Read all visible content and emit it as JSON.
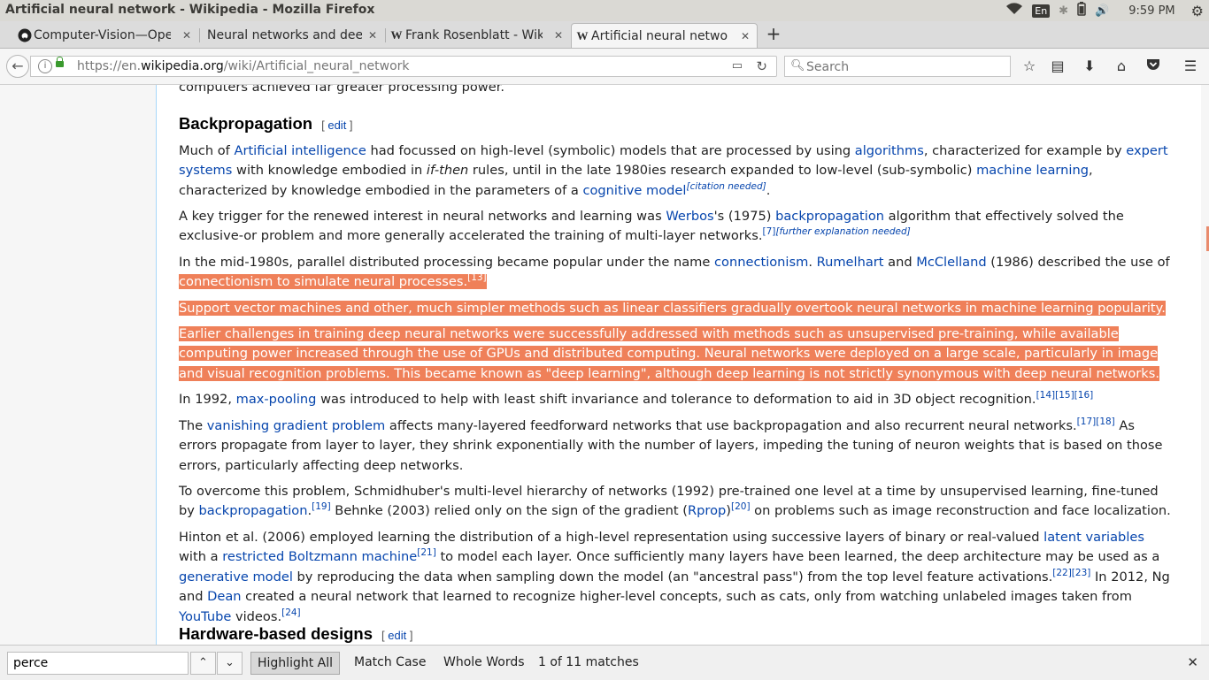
{
  "os": {
    "window_title": "Artificial neural network - Wikipedia - Mozilla Firefox",
    "input_lang": "En",
    "time": "9:59 PM"
  },
  "tabs": [
    {
      "title": "Computer-Vision—Ope",
      "favicon": "github-icon",
      "icon_char": "●"
    },
    {
      "title": "Neural networks and deep",
      "favicon": "none",
      "icon_char": ""
    },
    {
      "title": "Frank Rosenblatt - Wiki",
      "favicon": "wikipedia-icon",
      "icon_char": "W"
    },
    {
      "title": "Artificial neural netwo",
      "favicon": "wikipedia-icon",
      "icon_char": "W",
      "active": true
    }
  ],
  "nav": {
    "url_prefix": "https://en.",
    "url_domain": "wikipedia.org",
    "url_path": "/wiki/Artificial_neural_network",
    "search_placeholder": "Search"
  },
  "article": {
    "top_cut": "computers achieved far greater processing power.",
    "section1": {
      "title": "Backpropagation",
      "edit": "edit"
    },
    "p1": {
      "t1": "Much of ",
      "l1": "Artificial intelligence",
      "t2": " had focussed on high-level (symbolic) models that are processed by using ",
      "l2": "algorithms",
      "t3": ", characterized for example by ",
      "l3": "expert systems",
      "t4": " with knowledge embodied in ",
      "em": "if-then",
      "t5": " rules, until in the late 1980ies research expanded to low-level (sub-symbolic) ",
      "l4": "machine learning",
      "t6": ", characterized by knowledge embodied in the parameters of a ",
      "l5": "cognitive model",
      "sup": "[citation needed]",
      "t7": "."
    },
    "p2": {
      "t1": "A key trigger for the renewed interest in neural networks and learning was ",
      "l1": "Werbos",
      "t2": "'s (1975) ",
      "l2": "backpropagation",
      "t3": " algorithm that effectively solved the exclusive-or problem and more generally accelerated the training of multi-layer networks.",
      "sup1": "[7]",
      "sup2": "[further explanation needed]"
    },
    "p3": {
      "t1": "In the mid-1980s, parallel distributed processing became popular under the name ",
      "l1": "connectionism",
      "t2": ". ",
      "l2": "Rumelhart",
      "t3": " and ",
      "l3": "McClelland",
      "t4": " (1986) described the use of ",
      "hl": "connectionism to simulate neural processes.",
      "sup": "[13]"
    },
    "p4": "Support vector machines and other, much simpler methods such as linear classifiers gradually overtook neural networks in machine learning popularity.",
    "p5": "Earlier challenges in training deep neural networks were successfully addressed with methods such as unsupervised pre-training, while available computing power increased through the use of GPUs and distributed computing. Neural networks were deployed on a large scale, particularly in image and visual recognition problems. This became known as \"deep learning\", although deep learning is not strictly synonymous with deep neural networks.",
    "p6": {
      "t1": "In 1992, ",
      "l1": "max-pooling",
      "t2": " was introduced to help with least shift invariance and tolerance to deformation to aid in 3D object recognition.",
      "sup": "[14][15][16]"
    },
    "p7": {
      "t1": "The ",
      "l1": "vanishing gradient problem",
      "t2": " affects many-layered feedforward networks that use backpropagation and also recurrent neural networks.",
      "sup": "[17][18]",
      "t3": " As errors propagate from layer to layer, they shrink exponentially with the number of layers, impeding the tuning of neuron weights that is based on those errors, particularly affecting deep networks."
    },
    "p8": {
      "t1": "To overcome this problem, Schmidhuber's multi-level hierarchy of networks (1992) pre-trained one level at a time by unsupervised learning, fine-tuned by ",
      "l1": "backpropagation",
      "t2": ".",
      "sup1": "[19]",
      "t3": " Behnke (2003) relied only on the sign of the gradient (",
      "l2": "Rprop",
      "t4": ")",
      "sup2": "[20]",
      "t5": " on problems such as image reconstruction and face localization."
    },
    "p9": {
      "t1": "Hinton et al. (2006) employed learning the distribution of a high-level representation using successive layers of binary or real-valued ",
      "l1": "latent variables",
      "t2": " with a ",
      "l2": "restricted Boltzmann machine",
      "sup1": "[21]",
      "t3": " to model each layer. Once sufficiently many layers have been learned, the deep architecture may be used as a ",
      "l3": "generative model",
      "t4": " by reproducing the data when sampling down the model (an \"ancestral pass\") from the top level feature activations.",
      "sup2": "[22][23]",
      "t5": " In 2012, Ng and ",
      "l4": "Dean",
      "t6": " created a neural network that learned to recognize higher-level concepts, such as cats, only from watching unlabeled images taken from ",
      "l5": "YouTube",
      "t7": " videos.",
      "sup3": "[24]"
    },
    "section2": {
      "title": "Hardware-based designs",
      "edit": "edit"
    }
  },
  "findbar": {
    "query": "perce",
    "up": "⌃",
    "down": "⌄",
    "highlight_all": "Highlight All",
    "match_case": "Match Case",
    "whole_words": "Whole Words",
    "status": "1 of 11 matches",
    "close": "✕"
  },
  "colors": {
    "link": "#0645ad",
    "highlight": "#ef8059",
    "highlight_text": "#ffffff"
  }
}
